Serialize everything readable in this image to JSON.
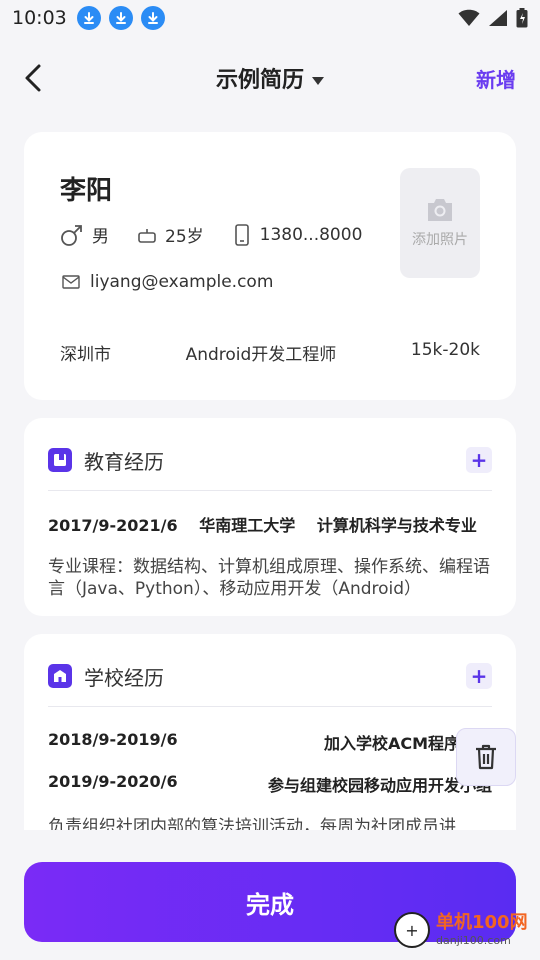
{
  "status_bar": {
    "time": "10:03"
  },
  "header": {
    "back_icon": "chevron-left-icon",
    "title": "示例简历",
    "add_label": "新增"
  },
  "profile": {
    "name": "李阳",
    "gender": "男",
    "age": "25岁",
    "phone": "1380...8000",
    "email": "liyang@example.com",
    "photo_label": "添加照片",
    "city": "深圳市",
    "position": "Android开发工程师",
    "salary": "15k-20k"
  },
  "education": {
    "title": "教育经历",
    "period": "2017/9-2021/6",
    "school": "华南理工大学",
    "major": "计算机科学与技术专业",
    "description": "专业课程：数据结构、计算机组成原理、操作系统、编程语言（Java、Python）、移动应用开发（Android）"
  },
  "school_experience": {
    "title": "学校经历",
    "items": [
      {
        "period": "2018/9-2019/6",
        "activity": "加入学校ACM程序设计"
      },
      {
        "period": "2019/9-2020/6",
        "activity": "参与组建校园移动应用开发小组"
      }
    ],
    "description": "负责组织社团内部的算法培训活动，每周为社团成员讲"
  },
  "done_label": "完成",
  "watermark": {
    "brand": "单机100网",
    "site": "danji100.com"
  },
  "colors": {
    "accent": "#5a34e8",
    "button_gradient_start": "#7a2bf6",
    "button_gradient_end": "#5a2cf2",
    "download_badge": "#2b8cf5"
  }
}
